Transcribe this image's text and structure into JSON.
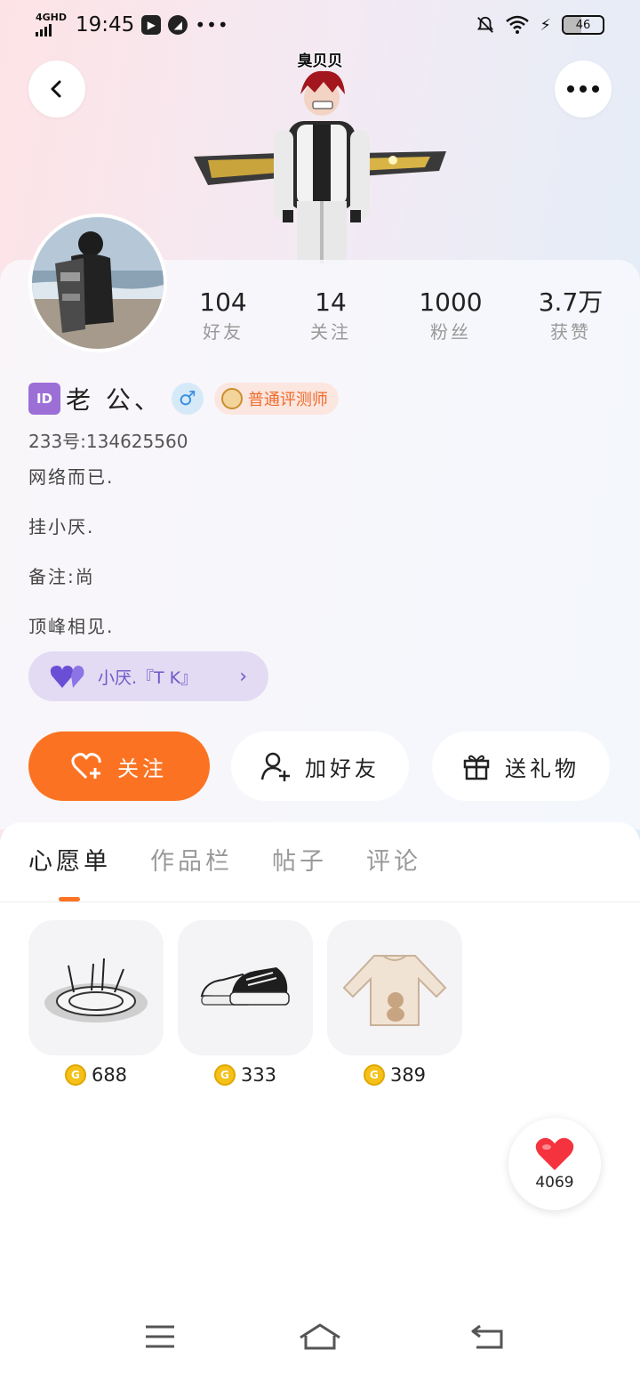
{
  "status_bar": {
    "network": "4GHD",
    "time": "19:45",
    "dots": "•••",
    "battery": "46",
    "battery_level": 0.46
  },
  "header": {
    "back_icon": "chevron-left-icon",
    "more_icon": "more-dots-icon",
    "character_name": "臭贝贝"
  },
  "profile": {
    "stats": [
      {
        "value": "104",
        "label": "好友"
      },
      {
        "value": "14",
        "label": "关注"
      },
      {
        "value": "1000",
        "label": "粉丝"
      },
      {
        "value": "3.7万",
        "label": "获赞"
      }
    ],
    "id_badge": "ID",
    "username": "老  公、",
    "gender_symbol": "♂",
    "role_badge": "普通评测师",
    "uid": "233号:134625560",
    "bio": [
      "网络而已.",
      "挂小厌.",
      "备注:尚",
      "顶峰相见."
    ],
    "partner": {
      "label": "小厌.『T K』",
      "arrow": "›"
    }
  },
  "actions": {
    "follow": "关注",
    "add_friend": "加好友",
    "send_gift": "送礼物"
  },
  "tabs": [
    "心愿单",
    "作品栏",
    "帖子",
    "评论"
  ],
  "wishlist": [
    {
      "name": "magic-circle-item",
      "price": "688"
    },
    {
      "name": "sneakers-item",
      "price": "333"
    },
    {
      "name": "sweater-item",
      "price": "389"
    }
  ],
  "like_fab": {
    "count": "4069"
  },
  "colors": {
    "accent": "#fb7322",
    "partner_bg": "#e2dbf3",
    "partner_text": "#6d59c8",
    "coin": "#f5c118"
  }
}
